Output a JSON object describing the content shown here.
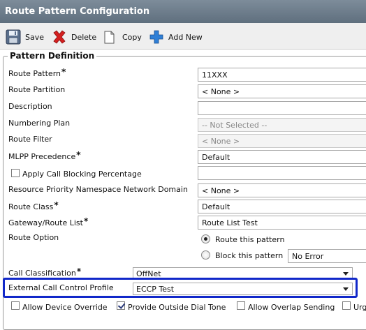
{
  "window": {
    "title": "Route Pattern Configuration"
  },
  "toolbar": {
    "save_label": "Save",
    "delete_label": "Delete",
    "copy_label": "Copy",
    "add_new_label": "Add New",
    "icons": {
      "save": "floppy-disk-icon",
      "delete": "red-x-icon",
      "copy": "copy-icon",
      "add_new": "plus-icon"
    }
  },
  "pattern_definition": {
    "legend": "Pattern Definition",
    "route_pattern": {
      "label": "Route Pattern",
      "required": "*",
      "value": "11XXX"
    },
    "route_partition": {
      "label": "Route Partition",
      "value": "< None >"
    },
    "description": {
      "label": "Description",
      "value": ""
    },
    "numbering_plan": {
      "label": "Numbering Plan",
      "value": "-- Not Selected --"
    },
    "route_filter": {
      "label": "Route Filter",
      "value": "< None >"
    },
    "mlpp_precedence": {
      "label": "MLPP Precedence",
      "required": "*",
      "value": "Default"
    },
    "apply_call_blocking": {
      "label": "Apply Call Blocking Percentage",
      "checked": false,
      "value": ""
    },
    "resource_priority": {
      "label": "Resource Priority Namespace Network Domain",
      "value": "< None >"
    },
    "route_class": {
      "label": "Route Class",
      "required": "*",
      "value": "Default"
    },
    "gateway_route_list": {
      "label": "Gateway/Route List",
      "required": "*",
      "value": "Route List Test"
    },
    "route_option": {
      "label": "Route Option",
      "route_this_pattern": "Route this pattern",
      "block_this_pattern": "Block this pattern",
      "block_reason": "No Error",
      "selected": "route"
    },
    "call_classification": {
      "label": "Call Classification",
      "required": "*",
      "value": "OffNet"
    },
    "external_call_control_profile": {
      "label": "External Call Control Profile",
      "value": "ECCP Test"
    },
    "checkboxes": {
      "allow_device_override": {
        "label": "Allow Device Override",
        "checked": false
      },
      "provide_outside_dial_tone": {
        "label": "Provide Outside Dial Tone",
        "checked": true
      },
      "allow_overlap_sending": {
        "label": "Allow Overlap Sending",
        "checked": false
      },
      "urgent_priority": {
        "label": "Urg",
        "checked": false
      }
    }
  },
  "colors": {
    "titlebar": "#6e7d8c",
    "highlight_box": "#1128c9",
    "delete_red": "#d42020",
    "add_blue": "#2f7fd6"
  }
}
